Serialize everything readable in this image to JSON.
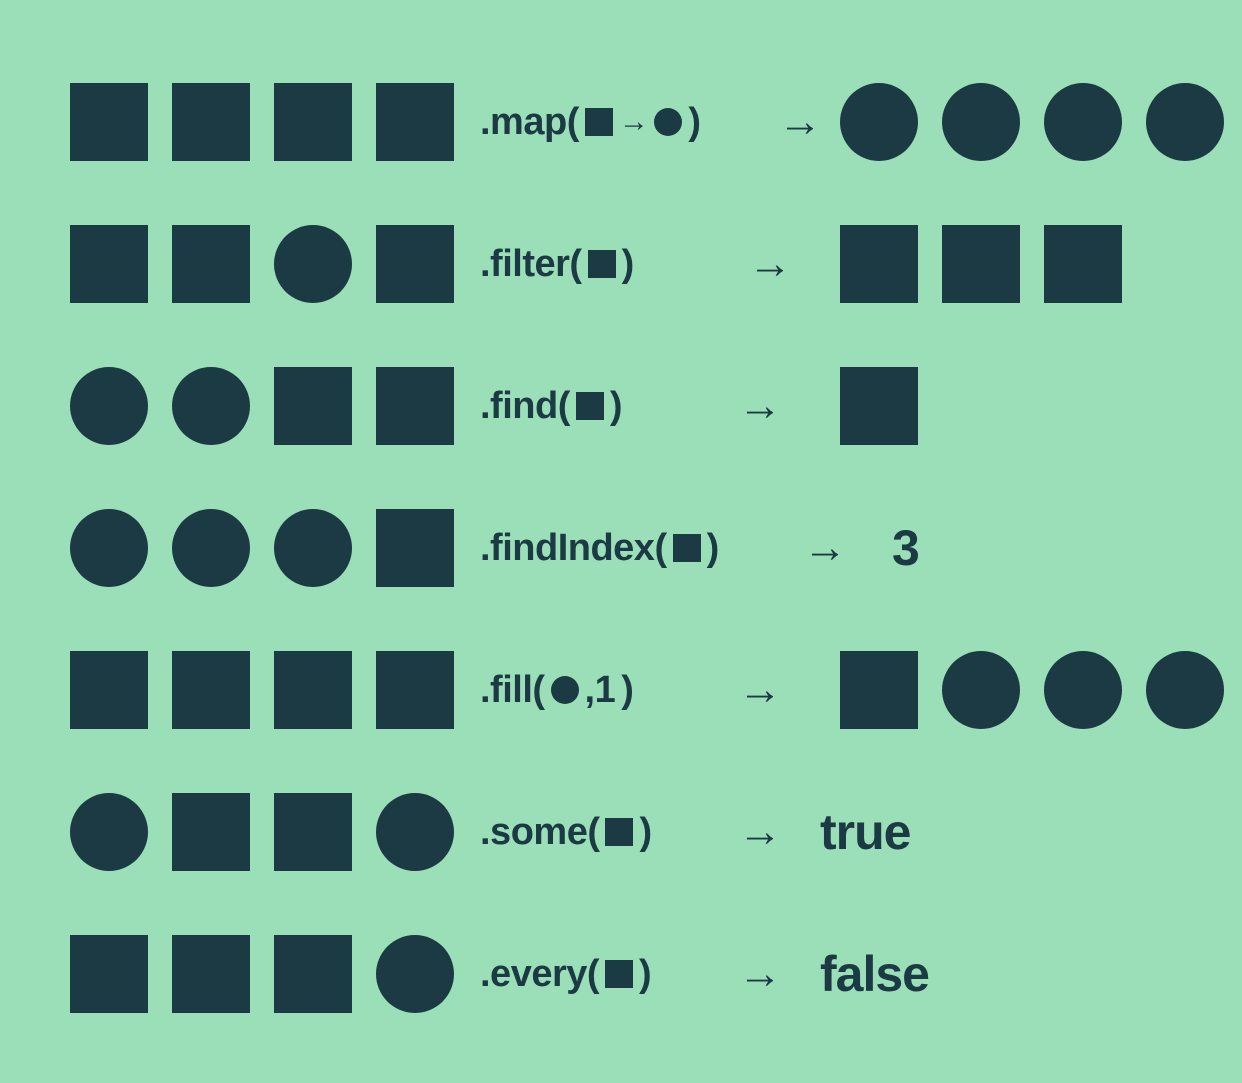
{
  "colors": {
    "bg": "#9BDFB9",
    "fg": "#1C3A44"
  },
  "glyphs": {
    "arrow": "→"
  },
  "rows": [
    {
      "id": "map",
      "row_class": "map-row",
      "input": [
        "square",
        "square",
        "square",
        "square"
      ],
      "method": {
        "prefix": ".map(",
        "args": [
          {
            "shape": "square"
          },
          {
            "arrow": true
          },
          {
            "shape": "circle"
          }
        ],
        "suffix": ")"
      },
      "arrow": "→",
      "output_type": "shapes",
      "output": [
        "circle",
        "circle",
        "circle",
        "circle"
      ]
    },
    {
      "id": "filter",
      "row_class": "filter-row",
      "input": [
        "square",
        "square",
        "circle",
        "square"
      ],
      "method": {
        "prefix": ".filter(",
        "args": [
          {
            "shape": "square"
          }
        ],
        "suffix": ")"
      },
      "arrow": "→",
      "output_type": "shapes",
      "output": [
        "square",
        "square",
        "square"
      ]
    },
    {
      "id": "find",
      "row_class": "find-row",
      "input": [
        "circle",
        "circle",
        "square",
        "square"
      ],
      "method": {
        "prefix": ".find(",
        "args": [
          {
            "shape": "square"
          }
        ],
        "suffix": ")"
      },
      "arrow": "→",
      "output_type": "shapes",
      "output": [
        "square"
      ]
    },
    {
      "id": "findIndex",
      "row_class": "findindex-row",
      "input": [
        "circle",
        "circle",
        "circle",
        "square"
      ],
      "method": {
        "prefix": ".findIndex(",
        "args": [
          {
            "shape": "square"
          }
        ],
        "suffix": ")"
      },
      "arrow": "→",
      "output_type": "text",
      "output_text": "3"
    },
    {
      "id": "fill",
      "row_class": "fill-row",
      "input": [
        "square",
        "square",
        "square",
        "square"
      ],
      "method": {
        "prefix": ".fill(",
        "args": [
          {
            "shape": "circle"
          },
          {
            "text": ",1 "
          }
        ],
        "suffix": ")"
      },
      "arrow": "→",
      "output_type": "shapes",
      "output": [
        "square",
        "circle",
        "circle",
        "circle"
      ]
    },
    {
      "id": "some",
      "row_class": "some-row",
      "input": [
        "circle",
        "square",
        "square",
        "circle"
      ],
      "method": {
        "prefix": ".some(",
        "args": [
          {
            "shape": "square"
          }
        ],
        "suffix": ")"
      },
      "arrow": "→",
      "output_type": "text",
      "output_text": "true"
    },
    {
      "id": "every",
      "row_class": "every-row",
      "input": [
        "square",
        "square",
        "square",
        "circle"
      ],
      "method": {
        "prefix": ".every(",
        "args": [
          {
            "shape": "square"
          }
        ],
        "suffix": ")"
      },
      "arrow": "→",
      "output_type": "text",
      "output_text": "false"
    }
  ]
}
